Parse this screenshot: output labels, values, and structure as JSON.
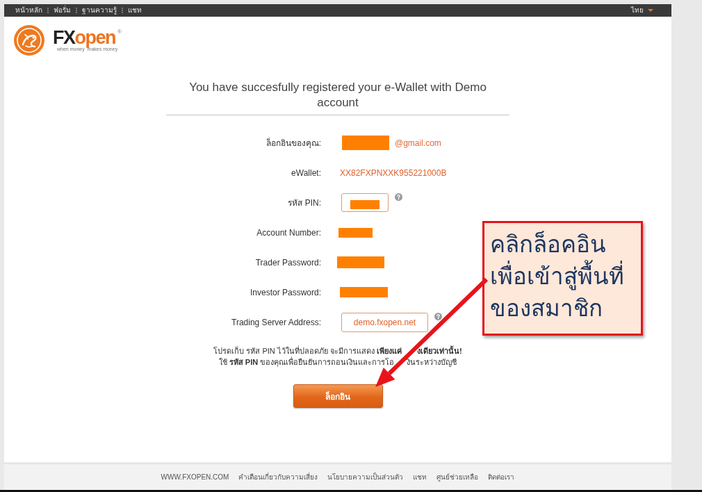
{
  "top_nav": {
    "links": [
      "หน้าหลัก",
      "ฟอรั่ม",
      "ฐานความรู้",
      "แชท"
    ],
    "language": "ไทย"
  },
  "logo": {
    "wordmark": [
      "FX",
      "open"
    ],
    "registered_mark": "®",
    "tagline": "when money  makes money"
  },
  "title": "You have succesfully registered your e-Wallet with Demo account",
  "fields": [
    {
      "label": "ล็อกอินของคุณ:",
      "value": "@gmail.com",
      "redacted": true,
      "boxed": false,
      "help": false
    },
    {
      "label": "eWallet:",
      "value": "XX82FXPNXXK955221000B",
      "redacted": false,
      "boxed": false,
      "help": false
    },
    {
      "label": "รหัส PIN:",
      "redacted": true,
      "boxed": true,
      "help": true
    },
    {
      "label": "Account Number:",
      "redacted": true,
      "boxed": false,
      "help": false
    },
    {
      "label": "Trader Password:",
      "redacted": true,
      "boxed": false,
      "help": false
    },
    {
      "label": "Investor Password:",
      "redacted": true,
      "boxed": false,
      "help": false
    },
    {
      "label": "Trading Server Address:",
      "value": "demo.fxopen.net",
      "redacted": false,
      "boxed": true,
      "help": true
    }
  ],
  "note": [
    [
      "โปรดเก็บ รหัส PIN ไว้ในที่ปลอดภัย จะมีการแสดง **เพียงแค่**",
      "**งเดียวเท่านั้น!**"
    ],
    [
      "ใช้ **รหัส PIN** ของคุณเพื่อยืนยันการถอนเงินและการโอ",
      "งินระหว่างบัญชี"
    ]
  ],
  "login_button": "ล็อกอิน",
  "callout": {
    "lines": [
      "คลิกล็อคอิน",
      "เพื่อเข้าสู่พื้นที่",
      "ของสมาชิก"
    ]
  },
  "footer": {
    "links": [
      "WWW.FXOPEN.COM",
      "คำเตือนเกี่ยวกับความเสี่ยง",
      "นโยบายความเป็นส่วนตัว",
      "แชท",
      "ศูนย์ช่วยเหลือ",
      "ติดต่อเรา"
    ]
  }
}
